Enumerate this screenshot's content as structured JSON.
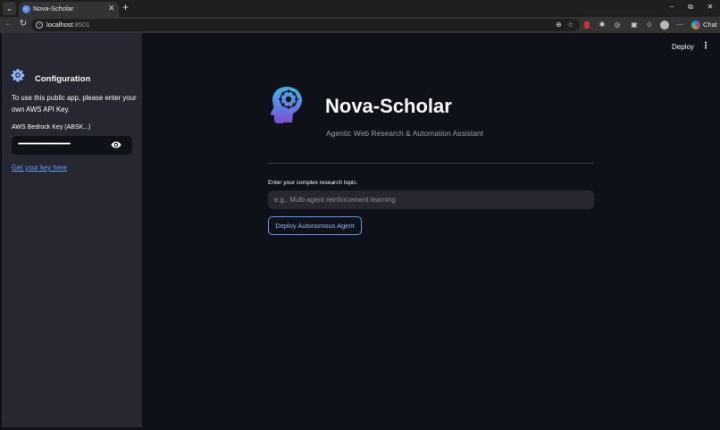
{
  "browser": {
    "tab_title": "Nova-Scholar",
    "tab_close": "✕",
    "new_tab": "+",
    "url_host": "localhost",
    "url_port": ":8501",
    "chat_label": "Chat",
    "window_controls": {
      "minimize": "–",
      "restore": "⧉",
      "close": "✕"
    }
  },
  "sidebar": {
    "title": "Configuration",
    "description": "To use this public app, please enter your own AWS API Key.",
    "key_label": "AWS Bedrock Key (ABSK...)",
    "key_value": "••••••••••••••••••••••••••••••••••••••••",
    "key_link": "Get your key here"
  },
  "header": {
    "deploy": "Deploy",
    "menu": "⋮"
  },
  "main": {
    "title": "Nova-Scholar",
    "subtitle": "Agentic Web Research & Automation Assistant",
    "topic_label": "Enter your complex research topic:",
    "topic_placeholder": "e.g., Multi-agent reinforcement learning",
    "topic_value": "",
    "submit_label": "Deploy Autonomous Agent"
  },
  "colors": {
    "app_bg": "#0e1117",
    "sidebar_bg": "#262730",
    "accent": "#5c9dff",
    "text": "#fafafa",
    "muted": "#9a9ca3"
  }
}
